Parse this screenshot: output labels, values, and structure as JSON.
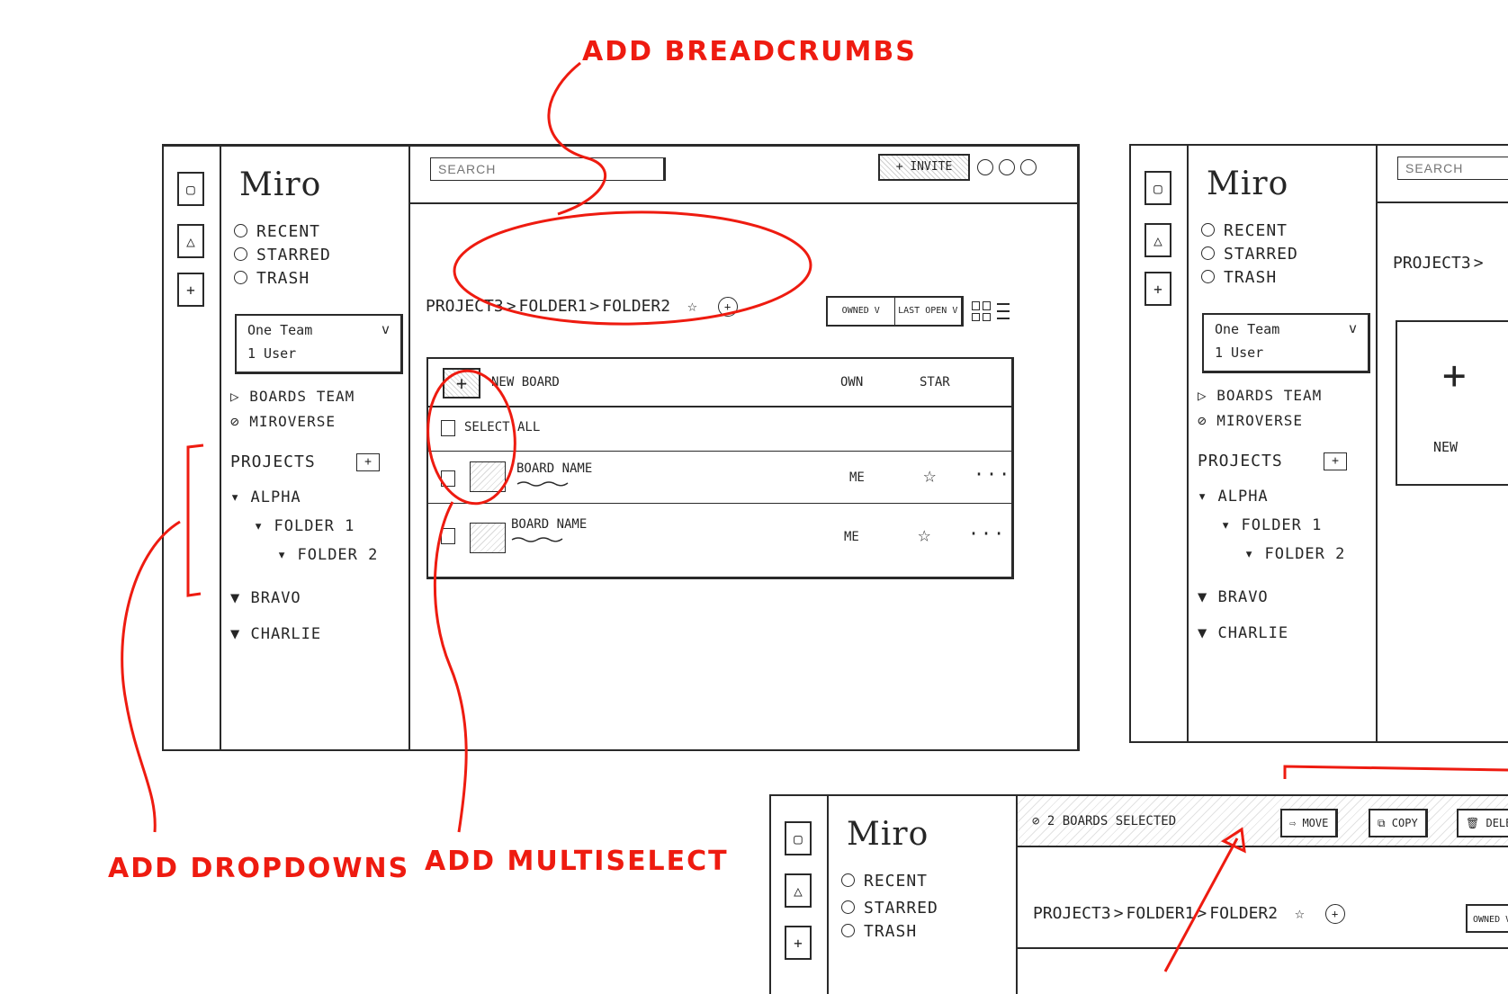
{
  "annotations": {
    "breadcrumbs": "ADD BREADCRUMBS",
    "dropdowns": "ADD DROPDOWNS",
    "multiselect": "ADD MULTISELECT"
  },
  "app": {
    "logo": "Miro",
    "nav": [
      "RECENT",
      "STARRED",
      "TRASH"
    ],
    "team": {
      "name": "One Team",
      "users": "1 User",
      "chevron": "v"
    },
    "boards_team": "BOARDS TEAM",
    "miroverse": "MIROVERSE",
    "projects_label": "PROJECTS",
    "projects_add": "+",
    "tree": {
      "alpha": "ALPHA",
      "folder1": "FOLDER 1",
      "folder2": "FOLDER 2",
      "bravo": "BRAVO",
      "charlie": "CHARLIE"
    },
    "search_placeholder": "SEARCH",
    "invite": "+ INVITE",
    "breadcrumb": [
      "PROJECT3",
      "FOLDER1",
      "FOLDER2"
    ],
    "breadcrumb_sep": ">",
    "star_glyph": "☆",
    "share_glyph": "+",
    "filters": [
      "OWNED V",
      "LAST OPEN V"
    ],
    "table": {
      "new_board": "NEW BOARD",
      "col_owner": "OWN",
      "col_star": "STAR",
      "select_all": "SELECT ALL",
      "rows": [
        {
          "name": "BOARD NAME",
          "owner": "ME"
        },
        {
          "name": "BOARD NAME",
          "owner": "ME"
        }
      ],
      "more": "···"
    },
    "grid_new": "NEW",
    "grid_plus": "+"
  },
  "selection": {
    "status": "2 BOARDS SELECTED",
    "move": "MOVE",
    "copy": "COPY",
    "delete": "DELE"
  },
  "colors": {
    "ink": "#2a2a2a",
    "annotation": "#ee1b10",
    "paper": "#ffffff"
  },
  "icons": {
    "rail": [
      "square-icon",
      "triangle-icon",
      "plus-box-icon"
    ],
    "filters": [
      "grid-view-icon",
      "list-view-icon"
    ]
  }
}
